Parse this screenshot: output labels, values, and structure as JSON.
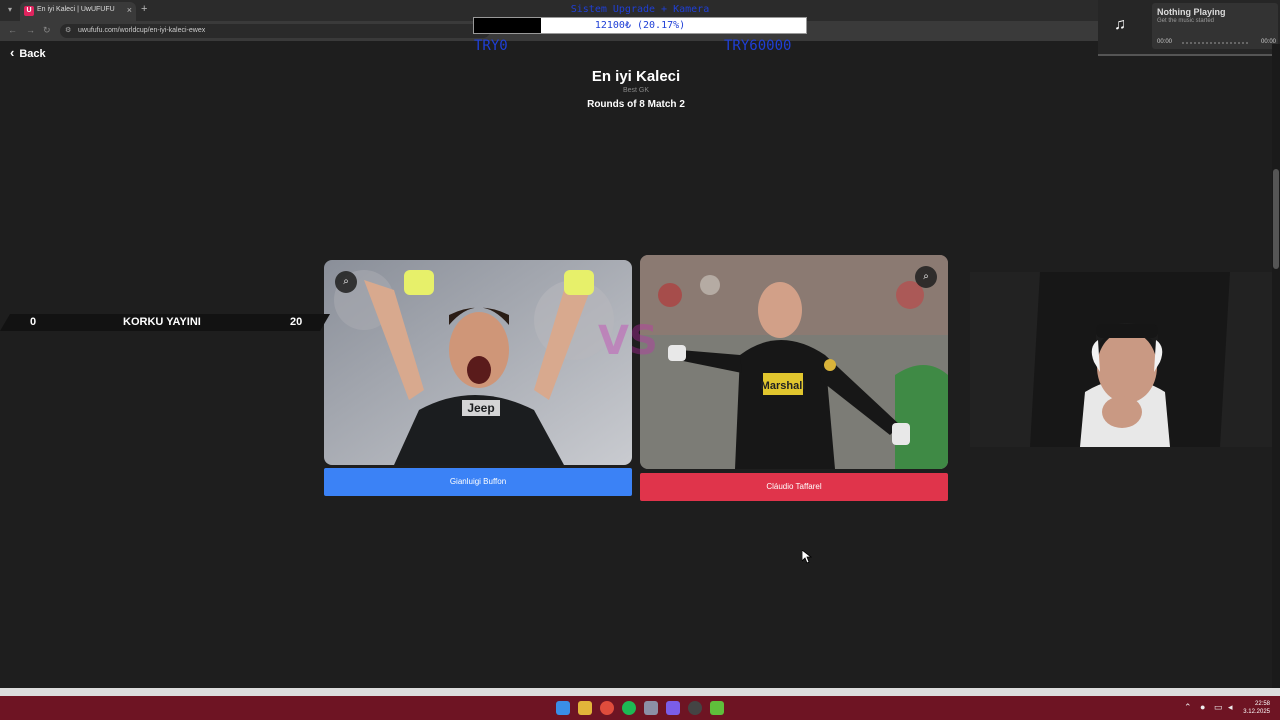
{
  "browser": {
    "tab_title": "En iyi Kaleci | UwUFUFU",
    "tab_favicon": "U",
    "url": "uwufufu.com/worldcup/en-iyi-kaleci-ewex"
  },
  "page": {
    "back_label": "Back",
    "title": "En iyi Kaleci",
    "subtitle": "Best GK",
    "round": "Rounds of 8 Match 2"
  },
  "candidates": [
    {
      "name": "Gianluigi Buffon",
      "button_color": "#3b82f6"
    },
    {
      "name": "Cláudio Taffarel",
      "button_color": "#e0344b"
    }
  ],
  "overlay": {
    "goal_title": "Sistem Upgrade + Kamera",
    "goal_amount": "12100₺ (20.17%)",
    "goal_progress": 0.2017,
    "goal_min": "TRY0",
    "goal_max": "TRY60000",
    "vs_text": "VS",
    "scoreboard": {
      "left_score": "0",
      "name": "KORKU YAYINI",
      "right_score": "20"
    },
    "music": {
      "title": "Nothing Playing",
      "subtitle": "Get the music started",
      "time_start": "00:00",
      "time_end": "00:00"
    }
  },
  "taskbar": {
    "time": "22:58",
    "date": "3.12.2025"
  },
  "colors": {
    "page_bg": "#1e1e1e",
    "goal_text": "#1f3fd6",
    "taskbar": "#6e1423"
  }
}
